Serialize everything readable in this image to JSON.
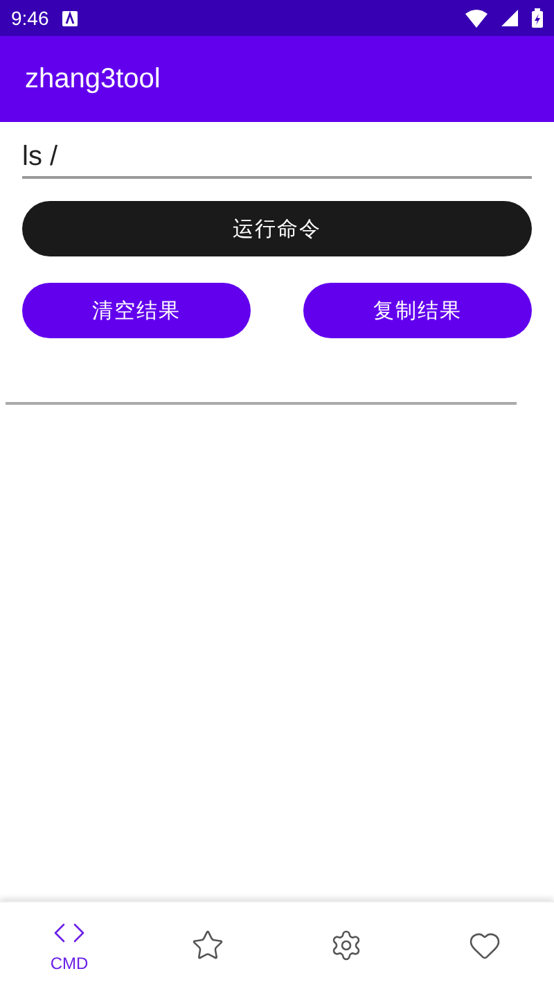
{
  "status_bar": {
    "time": "9:46"
  },
  "app_bar": {
    "title": "zhang3tool"
  },
  "command_field": {
    "value": "ls /"
  },
  "run_button": {
    "label": "运行命令"
  },
  "action_buttons": [
    {
      "label": "清空结果"
    },
    {
      "label": "复制结果"
    }
  ],
  "bottom_nav": [
    {
      "label": "CMD",
      "selected": true
    },
    {
      "selected": false
    },
    {
      "selected": false
    },
    {
      "selected": false
    }
  ]
}
